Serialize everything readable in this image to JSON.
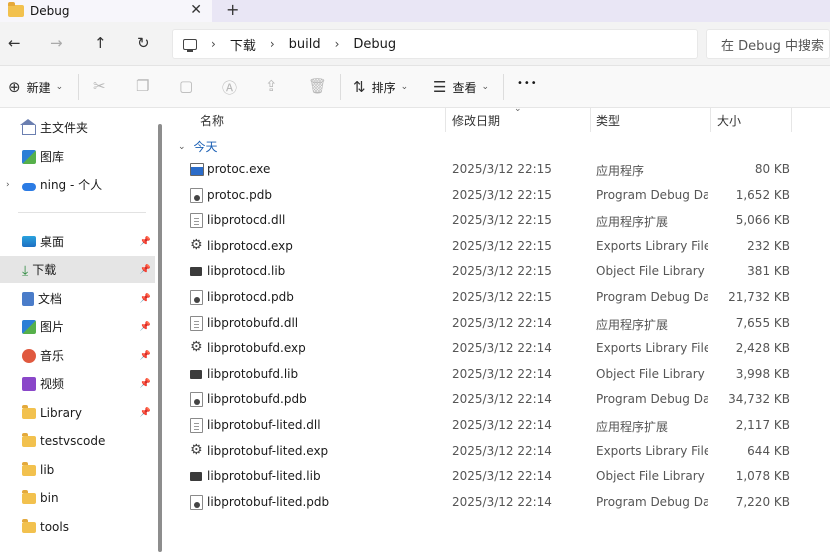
{
  "window": {
    "tab_title": "Debug",
    "close_glyph": "✕",
    "new_tab_glyph": "+"
  },
  "nav": {
    "back": "←",
    "forward": "→",
    "up": "↑",
    "refresh": "↻",
    "breadcrumb": [
      "下载",
      "build",
      "Debug"
    ],
    "separator": "›",
    "search_placeholder": "在 Debug 中搜索"
  },
  "toolbar": {
    "new_label": "新建",
    "sort_label": "排序",
    "view_label": "查看",
    "more_glyph": "•••"
  },
  "sidebar": {
    "top_items": [
      {
        "label": "主文件夹",
        "icon": "home-icon"
      },
      {
        "label": "图库",
        "icon": "gallery-icon"
      },
      {
        "label": "ning - 个人",
        "icon": "onedrive-cloud-icon"
      }
    ],
    "pinned_items": [
      {
        "label": "桌面",
        "icon": "desktop-icon",
        "pinned": true
      },
      {
        "label": "下载",
        "icon": "download-icon",
        "pinned": true,
        "selected": true
      },
      {
        "label": "文档",
        "icon": "documents-icon",
        "pinned": true
      },
      {
        "label": "图片",
        "icon": "pictures-icon",
        "pinned": true
      },
      {
        "label": "音乐",
        "icon": "music-icon",
        "pinned": true
      },
      {
        "label": "视频",
        "icon": "videos-icon",
        "pinned": true
      },
      {
        "label": "Library",
        "icon": "folder-icon",
        "pinned": true
      },
      {
        "label": "testvscode",
        "icon": "folder-icon",
        "pinned": false
      },
      {
        "label": "lib",
        "icon": "folder-icon",
        "pinned": false
      },
      {
        "label": "bin",
        "icon": "folder-icon",
        "pinned": false
      },
      {
        "label": "tools",
        "icon": "folder-icon",
        "pinned": false
      }
    ]
  },
  "columns": {
    "name": "名称",
    "date": "修改日期",
    "type": "类型",
    "size": "大小"
  },
  "group": {
    "label": "今天"
  },
  "files": [
    {
      "name": "protoc.exe",
      "date": "2025/3/12 22:15",
      "type": "应用程序",
      "size": "80 KB",
      "kind": "exe"
    },
    {
      "name": "protoc.pdb",
      "date": "2025/3/12 22:15",
      "type": "Program Debug Database",
      "size": "1,652 KB",
      "kind": "pdb"
    },
    {
      "name": "libprotocd.dll",
      "date": "2025/3/12 22:15",
      "type": "应用程序扩展",
      "size": "5,066 KB",
      "kind": "dll"
    },
    {
      "name": "libprotocd.exp",
      "date": "2025/3/12 22:15",
      "type": "Exports Library File",
      "size": "232 KB",
      "kind": "exp"
    },
    {
      "name": "libprotocd.lib",
      "date": "2025/3/12 22:15",
      "type": "Object File Library",
      "size": "381 KB",
      "kind": "lib"
    },
    {
      "name": "libprotocd.pdb",
      "date": "2025/3/12 22:15",
      "type": "Program Debug Database",
      "size": "21,732 KB",
      "kind": "pdb"
    },
    {
      "name": "libprotobufd.dll",
      "date": "2025/3/12 22:14",
      "type": "应用程序扩展",
      "size": "7,655 KB",
      "kind": "dll"
    },
    {
      "name": "libprotobufd.exp",
      "date": "2025/3/12 22:14",
      "type": "Exports Library File",
      "size": "2,428 KB",
      "kind": "exp"
    },
    {
      "name": "libprotobufd.lib",
      "date": "2025/3/12 22:14",
      "type": "Object File Library",
      "size": "3,998 KB",
      "kind": "lib"
    },
    {
      "name": "libprotobufd.pdb",
      "date": "2025/3/12 22:14",
      "type": "Program Debug Database",
      "size": "34,732 KB",
      "kind": "pdb"
    },
    {
      "name": "libprotobuf-lited.dll",
      "date": "2025/3/12 22:14",
      "type": "应用程序扩展",
      "size": "2,117 KB",
      "kind": "dll"
    },
    {
      "name": "libprotobuf-lited.exp",
      "date": "2025/3/12 22:14",
      "type": "Exports Library File",
      "size": "644 KB",
      "kind": "exp"
    },
    {
      "name": "libprotobuf-lited.lib",
      "date": "2025/3/12 22:14",
      "type": "Object File Library",
      "size": "1,078 KB",
      "kind": "lib"
    },
    {
      "name": "libprotobuf-lited.pdb",
      "date": "2025/3/12 22:14",
      "type": "Program Debug Database",
      "size": "7,220 KB",
      "kind": "pdb"
    }
  ]
}
